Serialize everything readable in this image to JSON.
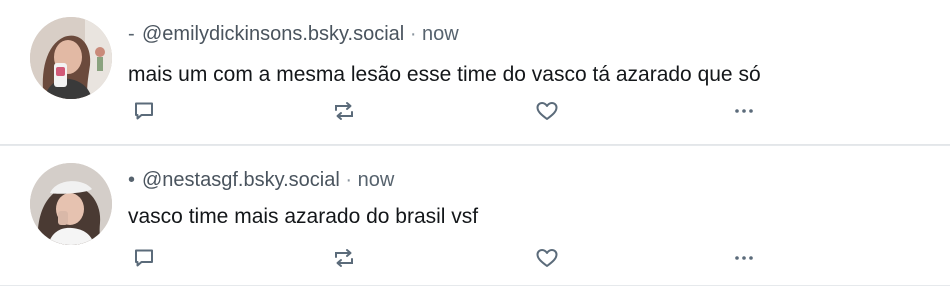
{
  "posts": [
    {
      "marker": "-",
      "handle": "@emilydickinsons.bsky.social",
      "separator": "·",
      "time": "now",
      "text": "mais um com a mesma lesão esse time do vasco tá azarado que só"
    },
    {
      "marker": "•",
      "handle": "@nestasgf.bsky.social",
      "separator": "·",
      "time": "now",
      "text": "vasco time mais azarado do brasil vsf"
    }
  ],
  "icons": {
    "reply": "reply-icon",
    "repost": "repost-icon",
    "like": "heart-icon",
    "more": "more-icon"
  },
  "colors": {
    "icon": "#5b6b7a",
    "meta": "#57636e",
    "text": "#14171a",
    "divider": "#e3e6e9"
  }
}
